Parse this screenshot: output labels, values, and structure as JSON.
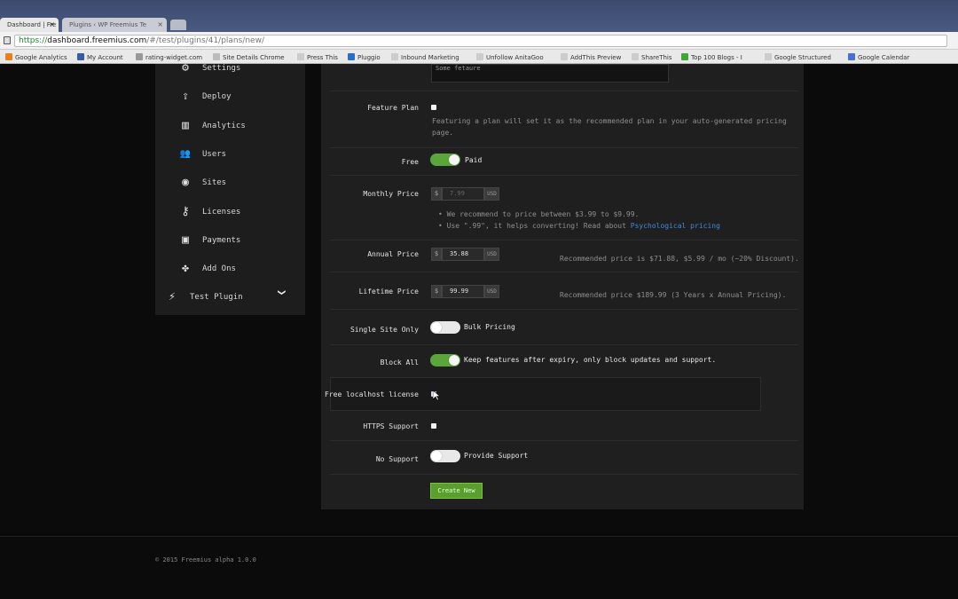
{
  "browser": {
    "tabs": [
      {
        "label": "Dashboard | Fre",
        "active": true
      },
      {
        "label": "Plugins ‹ WP Freemius Te",
        "active": false
      }
    ],
    "url": {
      "scheme": "https://",
      "host": "dashboard.freemius.com",
      "path": "/#/test/plugins/41/plans/new/"
    },
    "bookmarks": [
      "Google Analytics",
      "My Account",
      "rating-widget.com",
      "Site Details Chrome",
      "Press This",
      "Pluggio",
      "Inbound Marketing",
      "Unfollow AnitaGoo",
      "AddThis Preview",
      "ShareThis",
      "Top 100 Blogs - I",
      "Google Structured",
      "Google Calendar"
    ]
  },
  "sidebar": {
    "items": [
      {
        "label": "Settings",
        "icon": "gear-icon",
        "glyph": "⚙"
      },
      {
        "label": "Deploy",
        "icon": "upload-icon",
        "glyph": "⇪"
      },
      {
        "label": "Analytics",
        "icon": "chart-icon",
        "glyph": "▥"
      },
      {
        "label": "Users",
        "icon": "users-icon",
        "glyph": "👥"
      },
      {
        "label": "Sites",
        "icon": "globe-icon",
        "glyph": "◉"
      },
      {
        "label": "Licenses",
        "icon": "key-icon",
        "glyph": "⚷"
      },
      {
        "label": "Payments",
        "icon": "money-icon",
        "glyph": "▣"
      },
      {
        "label": "Add Ons",
        "icon": "puzzle-icon",
        "glyph": "✤"
      }
    ],
    "plugin": {
      "label": "Test Plugin",
      "glyph": "⚡",
      "chevron": "❯"
    }
  },
  "form": {
    "description_value": "Some fetaure",
    "feature_plan": {
      "label": "Feature Plan",
      "help": "Featuring a plan will set it as the recommended plan in your auto-generated pricing page."
    },
    "free": {
      "label": "Free",
      "toggle_label": "Paid",
      "on": true
    },
    "monthly": {
      "label": "Monthly Price",
      "currency": "$",
      "placeholder": "7.99",
      "suffix": "USD",
      "tip1": "• We recommend to price between $3.99 to $9.99.",
      "tip2_prefix": "• Use \".99\", it helps converting! Read about",
      "tip2_link": "Psychological pricing"
    },
    "annual": {
      "label": "Annual Price",
      "currency": "$",
      "value": "35.88",
      "suffix": "USD",
      "recommend": "Recommended price is $71.88, $5.99 / mo (~20% Discount)."
    },
    "lifetime": {
      "label": "Lifetime Price",
      "currency": "$",
      "value": "99.99",
      "suffix": "USD",
      "recommend": "Recommended price $189.99 (3 Years x Annual Pricing)."
    },
    "single_site": {
      "label": "Single Site Only",
      "toggle_label": "Bulk Pricing",
      "on": false
    },
    "block_all": {
      "label": "Block All",
      "toggle_label": "Keep features after expiry, only block updates and support.",
      "on": true
    },
    "free_localhost": {
      "label": "Free localhost license"
    },
    "https": {
      "label": "HTTPS Support"
    },
    "support": {
      "label": "No Support",
      "toggle_label": "Provide Support",
      "on": false
    },
    "submit_label": "Create New"
  },
  "footer": {
    "text": "© 2015 Freemius alpha 1.0.0"
  },
  "colors": {
    "accent_green": "#5aa63a",
    "link_blue": "#3b8be0",
    "panel_bg": "#1f1f1f"
  }
}
